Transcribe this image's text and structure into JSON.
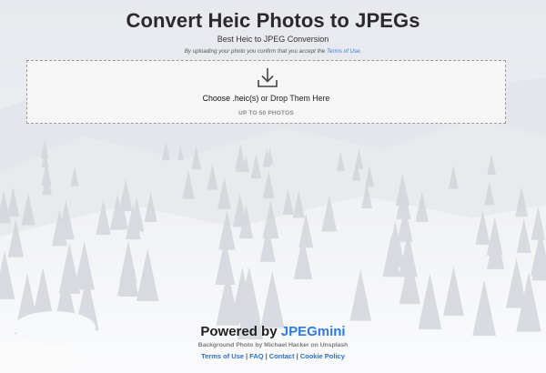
{
  "header": {
    "title": "Convert Heic Photos to JPEGs",
    "subtitle": "Best Heic to JPEG Conversion",
    "consent_text": "By uploading your photo you confirm that you accept the",
    "consent_link": "Terms of Use."
  },
  "dropzone": {
    "choose_label": "Choose .heic(s)",
    "drop_label": " or Drop Them Here",
    "limit_label": "UP TO 50 PHOTOS",
    "icon": "download-icon"
  },
  "footer": {
    "powered_prefix": "Powered by",
    "powered_brand": "JPEGmini",
    "credit": "Background Photo by Michael Hacker on Unsplash",
    "links": [
      "Terms of Use",
      "FAQ",
      "Contact",
      "Cookie Policy"
    ],
    "separator": "|"
  },
  "colors": {
    "brand": "#2f7be0",
    "link": "#2f6fc7",
    "dropzone_bg": "#f6f6f7"
  }
}
